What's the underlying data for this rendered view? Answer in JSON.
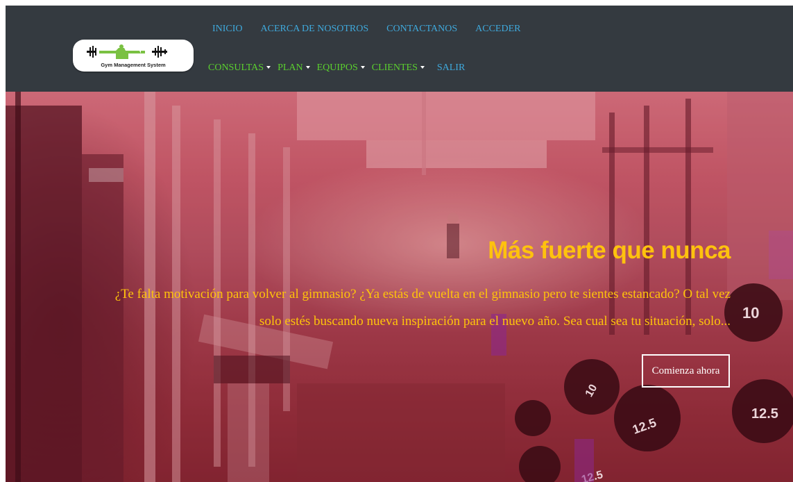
{
  "logo": {
    "text": "Gym Management System",
    "icon": "gym-logo-icon"
  },
  "nav": {
    "top": [
      {
        "label": "INICIO"
      },
      {
        "label": "ACERCA DE NOSOTROS"
      },
      {
        "label": "CONTACTANOS"
      },
      {
        "label": "ACCEDER"
      }
    ],
    "bottom": [
      {
        "label": "CONSULTAS"
      },
      {
        "label": "PLAN"
      },
      {
        "label": "EQUIPOS"
      },
      {
        "label": "CLIENTES"
      },
      {
        "label": "SALIR"
      }
    ]
  },
  "hero": {
    "title": "Más fuerte que nunca",
    "text": "¿Te falta motivación para volver al gimnasio? ¿Ya estás de vuelta en el gimnasio pero te sientes estancado? O tal vez solo estés buscando nueva inspiración para el nuevo año. Sea cual sea tu situación, solo...",
    "cta": "Comienza ahora",
    "plate_labels": [
      "10",
      "12.5",
      "12.5",
      "12.5",
      "10"
    ]
  },
  "colors": {
    "navbar_bg": "#343a40",
    "nav_blue": "#3fa9dc",
    "nav_green": "#5bd02e",
    "hero_accent": "#ffc20e"
  }
}
